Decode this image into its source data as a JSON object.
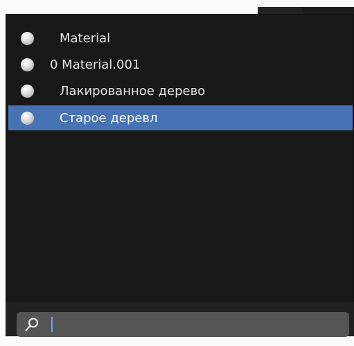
{
  "popup": {
    "items": [
      {
        "label": "Material",
        "icon": "material-preview-icon",
        "active": false
      },
      {
        "label": "0 Material.001",
        "icon": "material-preview-icon",
        "active": false
      },
      {
        "label": "Лакированное дерево",
        "icon": "material-preview-icon",
        "active": false
      },
      {
        "label": "Старое деревл",
        "icon": "material-preview-icon",
        "active": true
      }
    ],
    "search": {
      "value": "",
      "icon": "search-icon"
    }
  },
  "colors": {
    "popup_bg": "#181818",
    "highlight": "#4772b3",
    "search_bg": "#545454",
    "caret": "#6aa7ff"
  }
}
